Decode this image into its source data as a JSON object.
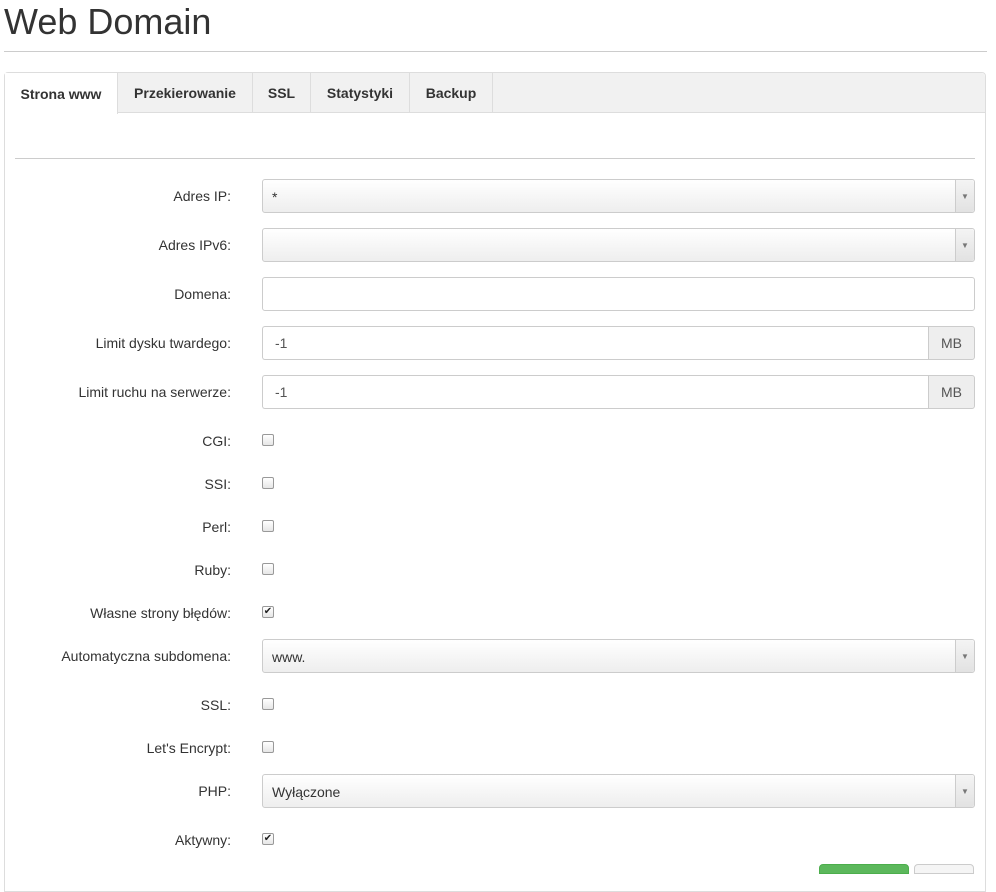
{
  "page": {
    "title": "Web Domain"
  },
  "tabs": [
    {
      "label": "Strona www",
      "active": true
    },
    {
      "label": "Przekierowanie",
      "active": false
    },
    {
      "label": "SSL",
      "active": false
    },
    {
      "label": "Statystyki",
      "active": false
    },
    {
      "label": "Backup",
      "active": false
    }
  ],
  "form": {
    "ip": {
      "label": "Adres IP:",
      "value": "*"
    },
    "ipv6": {
      "label": "Adres IPv6:",
      "value": ""
    },
    "domain": {
      "label": "Domena:",
      "value": ""
    },
    "hd_quota": {
      "label": "Limit dysku twardego:",
      "value": "-1",
      "unit": "MB"
    },
    "traffic_quota": {
      "label": "Limit ruchu na serwerze:",
      "value": "-1",
      "unit": "MB"
    },
    "cgi": {
      "label": "CGI:",
      "checked": false
    },
    "ssi": {
      "label": "SSI:",
      "checked": false
    },
    "perl": {
      "label": "Perl:",
      "checked": false
    },
    "ruby": {
      "label": "Ruby:",
      "checked": false
    },
    "errordocs": {
      "label": "Własne strony błędów:",
      "checked": true
    },
    "subdomain": {
      "label": "Automatyczna subdomena:",
      "value": "www."
    },
    "ssl": {
      "label": "SSL:",
      "checked": false
    },
    "letsencrypt": {
      "label": "Let's Encrypt:",
      "checked": false
    },
    "php": {
      "label": "PHP:",
      "value": "Wyłączone"
    },
    "active": {
      "label": "Aktywny:",
      "checked": true
    }
  },
  "icons": {
    "dropdown": "chevron-down-icon",
    "check": "check-icon"
  },
  "colors": {
    "save_button": "#5cb85c",
    "cancel_button": "#f5f5f5"
  }
}
